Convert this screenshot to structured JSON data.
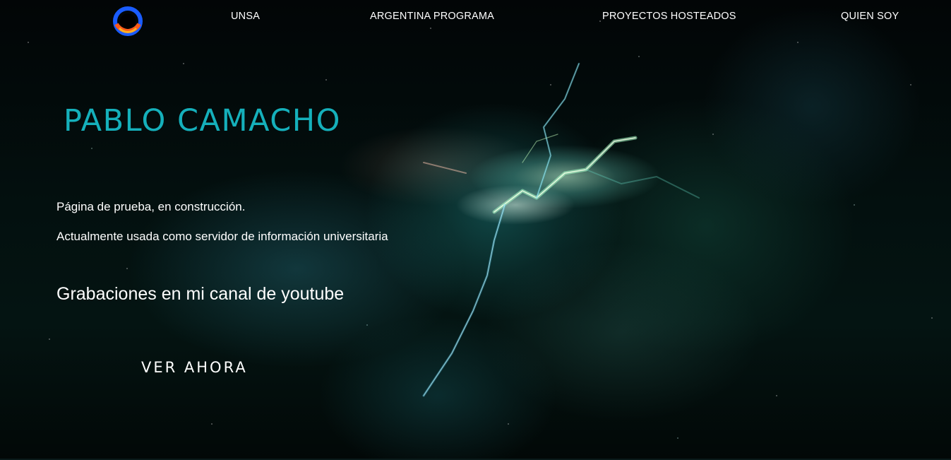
{
  "nav": {
    "logo_icon": "circular-fire-logo-icon",
    "items": [
      {
        "label": "UNSA"
      },
      {
        "label": "ARGENTINA PROGRAMA"
      },
      {
        "label": "PROYECTOS HOSTEADOS"
      },
      {
        "label": "QUIEN SOY"
      }
    ]
  },
  "hero": {
    "title": "PABLO CAMACHO",
    "paragraphs": [
      "Página de prueba, en construcción.",
      "Actualmente usada como servidor de información universitaria"
    ],
    "subtitle": "Grabaciones en mi canal de youtube",
    "cta_label": "VER AHORA"
  },
  "colors": {
    "title": "#15b0bb",
    "text": "#ffffff",
    "background": "#03100f"
  }
}
